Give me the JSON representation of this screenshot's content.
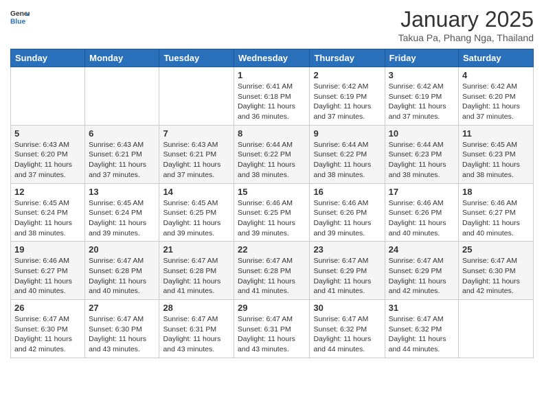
{
  "header": {
    "logo": {
      "general": "General",
      "blue": "Blue"
    },
    "title": "January 2025",
    "subtitle": "Takua Pa, Phang Nga, Thailand"
  },
  "weekdays": [
    "Sunday",
    "Monday",
    "Tuesday",
    "Wednesday",
    "Thursday",
    "Friday",
    "Saturday"
  ],
  "weeks": [
    [
      {
        "day": "",
        "sunrise": "",
        "sunset": "",
        "daylight": ""
      },
      {
        "day": "",
        "sunrise": "",
        "sunset": "",
        "daylight": ""
      },
      {
        "day": "",
        "sunrise": "",
        "sunset": "",
        "daylight": ""
      },
      {
        "day": "1",
        "sunrise": "Sunrise: 6:41 AM",
        "sunset": "Sunset: 6:18 PM",
        "daylight": "Daylight: 11 hours and 36 minutes."
      },
      {
        "day": "2",
        "sunrise": "Sunrise: 6:42 AM",
        "sunset": "Sunset: 6:19 PM",
        "daylight": "Daylight: 11 hours and 37 minutes."
      },
      {
        "day": "3",
        "sunrise": "Sunrise: 6:42 AM",
        "sunset": "Sunset: 6:19 PM",
        "daylight": "Daylight: 11 hours and 37 minutes."
      },
      {
        "day": "4",
        "sunrise": "Sunrise: 6:42 AM",
        "sunset": "Sunset: 6:20 PM",
        "daylight": "Daylight: 11 hours and 37 minutes."
      }
    ],
    [
      {
        "day": "5",
        "sunrise": "Sunrise: 6:43 AM",
        "sunset": "Sunset: 6:20 PM",
        "daylight": "Daylight: 11 hours and 37 minutes."
      },
      {
        "day": "6",
        "sunrise": "Sunrise: 6:43 AM",
        "sunset": "Sunset: 6:21 PM",
        "daylight": "Daylight: 11 hours and 37 minutes."
      },
      {
        "day": "7",
        "sunrise": "Sunrise: 6:43 AM",
        "sunset": "Sunset: 6:21 PM",
        "daylight": "Daylight: 11 hours and 37 minutes."
      },
      {
        "day": "8",
        "sunrise": "Sunrise: 6:44 AM",
        "sunset": "Sunset: 6:22 PM",
        "daylight": "Daylight: 11 hours and 38 minutes."
      },
      {
        "day": "9",
        "sunrise": "Sunrise: 6:44 AM",
        "sunset": "Sunset: 6:22 PM",
        "daylight": "Daylight: 11 hours and 38 minutes."
      },
      {
        "day": "10",
        "sunrise": "Sunrise: 6:44 AM",
        "sunset": "Sunset: 6:23 PM",
        "daylight": "Daylight: 11 hours and 38 minutes."
      },
      {
        "day": "11",
        "sunrise": "Sunrise: 6:45 AM",
        "sunset": "Sunset: 6:23 PM",
        "daylight": "Daylight: 11 hours and 38 minutes."
      }
    ],
    [
      {
        "day": "12",
        "sunrise": "Sunrise: 6:45 AM",
        "sunset": "Sunset: 6:24 PM",
        "daylight": "Daylight: 11 hours and 38 minutes."
      },
      {
        "day": "13",
        "sunrise": "Sunrise: 6:45 AM",
        "sunset": "Sunset: 6:24 PM",
        "daylight": "Daylight: 11 hours and 39 minutes."
      },
      {
        "day": "14",
        "sunrise": "Sunrise: 6:45 AM",
        "sunset": "Sunset: 6:25 PM",
        "daylight": "Daylight: 11 hours and 39 minutes."
      },
      {
        "day": "15",
        "sunrise": "Sunrise: 6:46 AM",
        "sunset": "Sunset: 6:25 PM",
        "daylight": "Daylight: 11 hours and 39 minutes."
      },
      {
        "day": "16",
        "sunrise": "Sunrise: 6:46 AM",
        "sunset": "Sunset: 6:26 PM",
        "daylight": "Daylight: 11 hours and 39 minutes."
      },
      {
        "day": "17",
        "sunrise": "Sunrise: 6:46 AM",
        "sunset": "Sunset: 6:26 PM",
        "daylight": "Daylight: 11 hours and 40 minutes."
      },
      {
        "day": "18",
        "sunrise": "Sunrise: 6:46 AM",
        "sunset": "Sunset: 6:27 PM",
        "daylight": "Daylight: 11 hours and 40 minutes."
      }
    ],
    [
      {
        "day": "19",
        "sunrise": "Sunrise: 6:46 AM",
        "sunset": "Sunset: 6:27 PM",
        "daylight": "Daylight: 11 hours and 40 minutes."
      },
      {
        "day": "20",
        "sunrise": "Sunrise: 6:47 AM",
        "sunset": "Sunset: 6:28 PM",
        "daylight": "Daylight: 11 hours and 40 minutes."
      },
      {
        "day": "21",
        "sunrise": "Sunrise: 6:47 AM",
        "sunset": "Sunset: 6:28 PM",
        "daylight": "Daylight: 11 hours and 41 minutes."
      },
      {
        "day": "22",
        "sunrise": "Sunrise: 6:47 AM",
        "sunset": "Sunset: 6:28 PM",
        "daylight": "Daylight: 11 hours and 41 minutes."
      },
      {
        "day": "23",
        "sunrise": "Sunrise: 6:47 AM",
        "sunset": "Sunset: 6:29 PM",
        "daylight": "Daylight: 11 hours and 41 minutes."
      },
      {
        "day": "24",
        "sunrise": "Sunrise: 6:47 AM",
        "sunset": "Sunset: 6:29 PM",
        "daylight": "Daylight: 11 hours and 42 minutes."
      },
      {
        "day": "25",
        "sunrise": "Sunrise: 6:47 AM",
        "sunset": "Sunset: 6:30 PM",
        "daylight": "Daylight: 11 hours and 42 minutes."
      }
    ],
    [
      {
        "day": "26",
        "sunrise": "Sunrise: 6:47 AM",
        "sunset": "Sunset: 6:30 PM",
        "daylight": "Daylight: 11 hours and 42 minutes."
      },
      {
        "day": "27",
        "sunrise": "Sunrise: 6:47 AM",
        "sunset": "Sunset: 6:30 PM",
        "daylight": "Daylight: 11 hours and 43 minutes."
      },
      {
        "day": "28",
        "sunrise": "Sunrise: 6:47 AM",
        "sunset": "Sunset: 6:31 PM",
        "daylight": "Daylight: 11 hours and 43 minutes."
      },
      {
        "day": "29",
        "sunrise": "Sunrise: 6:47 AM",
        "sunset": "Sunset: 6:31 PM",
        "daylight": "Daylight: 11 hours and 43 minutes."
      },
      {
        "day": "30",
        "sunrise": "Sunrise: 6:47 AM",
        "sunset": "Sunset: 6:32 PM",
        "daylight": "Daylight: 11 hours and 44 minutes."
      },
      {
        "day": "31",
        "sunrise": "Sunrise: 6:47 AM",
        "sunset": "Sunset: 6:32 PM",
        "daylight": "Daylight: 11 hours and 44 minutes."
      },
      {
        "day": "",
        "sunrise": "",
        "sunset": "",
        "daylight": ""
      }
    ]
  ]
}
